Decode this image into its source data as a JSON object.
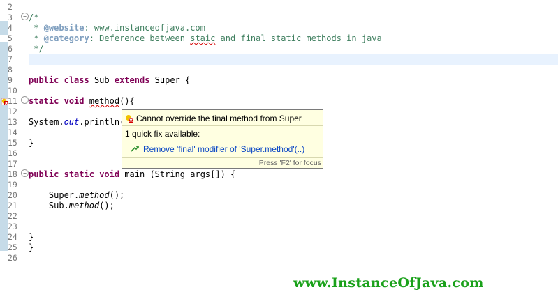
{
  "editor": {
    "line_numbers": [
      "2",
      "3",
      "4",
      "5",
      "6",
      "7",
      "8",
      "9",
      "10",
      "11",
      "12",
      "13",
      "14",
      "15",
      "16",
      "17",
      "18",
      "19",
      "20",
      "21",
      "22",
      "23",
      "24",
      "25",
      "26"
    ],
    "code": {
      "l3": "/*",
      "l4_pre": " * ",
      "l4_tag": "@website",
      "l4_rest": ": www.instanceofjava.com",
      "l5_pre": " * ",
      "l5_tag": "@category",
      "l5_a": ": Deference between ",
      "l5_b": "staic",
      "l5_c": " and final static methods in java",
      "l6": " */",
      "l9_kw1": "public",
      "l9_kw2": "class",
      "l9_name": " Sub ",
      "l9_kw3": "extends",
      "l9_rest": " Super {",
      "l11_kw1": "static",
      "l11_kw2": "void",
      "l11_method": "method",
      "l11_rest": "(){",
      "l13_a": "System.",
      "l13_b": "out",
      "l13_c": ".println(",
      "l15": "}",
      "l18_kw1": "public",
      "l18_kw2": "static",
      "l18_kw3": "void",
      "l18_rest": " main (String args[]) {",
      "l20_a": "    Super.",
      "l20_b": "method",
      "l20_c": "();",
      "l21_a": "    Sub.",
      "l21_b": "method",
      "l21_c": "();",
      "l24": "}",
      "l25": "}"
    }
  },
  "tooltip": {
    "message": "Cannot override the final method from Super",
    "count": "1 quick fix available:",
    "fix": "Remove 'final' modifier of 'Super.method'(..)",
    "footer": "Press 'F2' for focus"
  },
  "watermark": "www.InstanceOfJava.com",
  "colors": {
    "keyword": "#7f0055",
    "comment": "#3f7f5f",
    "error": "#d40000",
    "link": "#0b47c5"
  }
}
